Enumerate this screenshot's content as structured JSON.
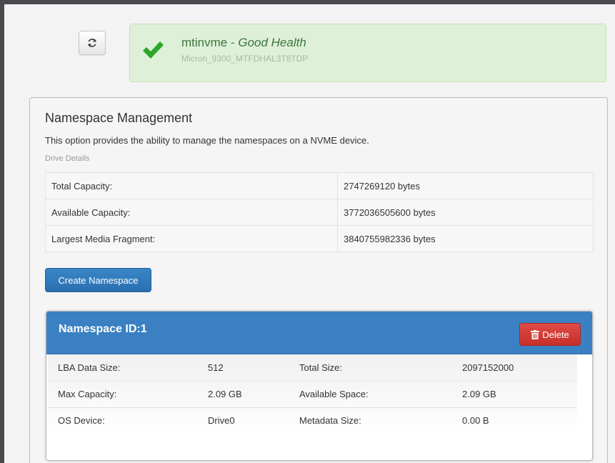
{
  "header": {
    "refresh_icon": "refresh-icon",
    "health": {
      "device_name": "mtinvme",
      "separator": " - ",
      "status": "Good Health",
      "model": "Micron_9300_MTFDHAL3T8TDP",
      "status_color": "#3c763d",
      "icon": "check-icon",
      "icon_color": "#2aa82a"
    }
  },
  "panel": {
    "title": "Namespace Management",
    "description": "This option provides the ability to manage the namespaces on a NVME device.",
    "details_label": "Drive Details",
    "details": [
      {
        "label": "Total Capacity:",
        "value": "2747269120 bytes"
      },
      {
        "label": "Available Capacity:",
        "value": "3772036505600 bytes"
      },
      {
        "label": "Largest Media Fragment:",
        "value": "3840755982336 bytes"
      }
    ],
    "create_button": "Create Namespace"
  },
  "namespace": {
    "title": "Namespace ID:1",
    "delete_button": "Delete",
    "delete_icon": "trash-icon",
    "rows": [
      {
        "l1": "LBA Data Size:",
        "v1": "512",
        "l2": "Total Size:",
        "v2": "2097152000"
      },
      {
        "l1": "Max Capacity:",
        "v1": "2.09 GB",
        "l2": "Available Space:",
        "v2": "2.09 GB"
      },
      {
        "l1": "OS Device:",
        "v1": "Drive0",
        "l2": "Metadata Size:",
        "v2": "0.00 B"
      }
    ]
  },
  "colors": {
    "accent": "#3a80c2",
    "danger": "#d9534f",
    "success_bg": "#dff0d8"
  }
}
